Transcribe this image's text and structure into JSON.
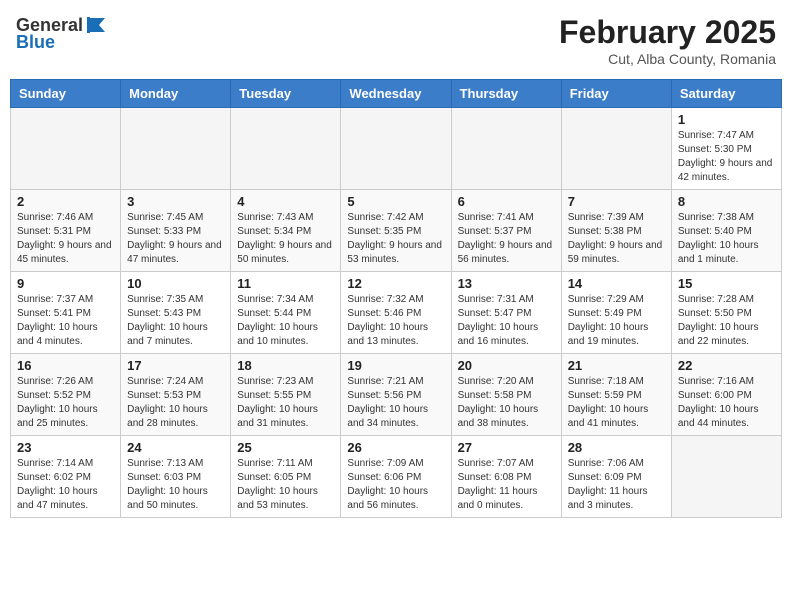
{
  "header": {
    "logo_general": "General",
    "logo_blue": "Blue",
    "month_title": "February 2025",
    "location": "Cut, Alba County, Romania"
  },
  "days_of_week": [
    "Sunday",
    "Monday",
    "Tuesday",
    "Wednesday",
    "Thursday",
    "Friday",
    "Saturday"
  ],
  "weeks": [
    [
      {
        "day": "",
        "info": ""
      },
      {
        "day": "",
        "info": ""
      },
      {
        "day": "",
        "info": ""
      },
      {
        "day": "",
        "info": ""
      },
      {
        "day": "",
        "info": ""
      },
      {
        "day": "",
        "info": ""
      },
      {
        "day": "1",
        "info": "Sunrise: 7:47 AM\nSunset: 5:30 PM\nDaylight: 9 hours and 42 minutes."
      }
    ],
    [
      {
        "day": "2",
        "info": "Sunrise: 7:46 AM\nSunset: 5:31 PM\nDaylight: 9 hours and 45 minutes."
      },
      {
        "day": "3",
        "info": "Sunrise: 7:45 AM\nSunset: 5:33 PM\nDaylight: 9 hours and 47 minutes."
      },
      {
        "day": "4",
        "info": "Sunrise: 7:43 AM\nSunset: 5:34 PM\nDaylight: 9 hours and 50 minutes."
      },
      {
        "day": "5",
        "info": "Sunrise: 7:42 AM\nSunset: 5:35 PM\nDaylight: 9 hours and 53 minutes."
      },
      {
        "day": "6",
        "info": "Sunrise: 7:41 AM\nSunset: 5:37 PM\nDaylight: 9 hours and 56 minutes."
      },
      {
        "day": "7",
        "info": "Sunrise: 7:39 AM\nSunset: 5:38 PM\nDaylight: 9 hours and 59 minutes."
      },
      {
        "day": "8",
        "info": "Sunrise: 7:38 AM\nSunset: 5:40 PM\nDaylight: 10 hours and 1 minute."
      }
    ],
    [
      {
        "day": "9",
        "info": "Sunrise: 7:37 AM\nSunset: 5:41 PM\nDaylight: 10 hours and 4 minutes."
      },
      {
        "day": "10",
        "info": "Sunrise: 7:35 AM\nSunset: 5:43 PM\nDaylight: 10 hours and 7 minutes."
      },
      {
        "day": "11",
        "info": "Sunrise: 7:34 AM\nSunset: 5:44 PM\nDaylight: 10 hours and 10 minutes."
      },
      {
        "day": "12",
        "info": "Sunrise: 7:32 AM\nSunset: 5:46 PM\nDaylight: 10 hours and 13 minutes."
      },
      {
        "day": "13",
        "info": "Sunrise: 7:31 AM\nSunset: 5:47 PM\nDaylight: 10 hours and 16 minutes."
      },
      {
        "day": "14",
        "info": "Sunrise: 7:29 AM\nSunset: 5:49 PM\nDaylight: 10 hours and 19 minutes."
      },
      {
        "day": "15",
        "info": "Sunrise: 7:28 AM\nSunset: 5:50 PM\nDaylight: 10 hours and 22 minutes."
      }
    ],
    [
      {
        "day": "16",
        "info": "Sunrise: 7:26 AM\nSunset: 5:52 PM\nDaylight: 10 hours and 25 minutes."
      },
      {
        "day": "17",
        "info": "Sunrise: 7:24 AM\nSunset: 5:53 PM\nDaylight: 10 hours and 28 minutes."
      },
      {
        "day": "18",
        "info": "Sunrise: 7:23 AM\nSunset: 5:55 PM\nDaylight: 10 hours and 31 minutes."
      },
      {
        "day": "19",
        "info": "Sunrise: 7:21 AM\nSunset: 5:56 PM\nDaylight: 10 hours and 34 minutes."
      },
      {
        "day": "20",
        "info": "Sunrise: 7:20 AM\nSunset: 5:58 PM\nDaylight: 10 hours and 38 minutes."
      },
      {
        "day": "21",
        "info": "Sunrise: 7:18 AM\nSunset: 5:59 PM\nDaylight: 10 hours and 41 minutes."
      },
      {
        "day": "22",
        "info": "Sunrise: 7:16 AM\nSunset: 6:00 PM\nDaylight: 10 hours and 44 minutes."
      }
    ],
    [
      {
        "day": "23",
        "info": "Sunrise: 7:14 AM\nSunset: 6:02 PM\nDaylight: 10 hours and 47 minutes."
      },
      {
        "day": "24",
        "info": "Sunrise: 7:13 AM\nSunset: 6:03 PM\nDaylight: 10 hours and 50 minutes."
      },
      {
        "day": "25",
        "info": "Sunrise: 7:11 AM\nSunset: 6:05 PM\nDaylight: 10 hours and 53 minutes."
      },
      {
        "day": "26",
        "info": "Sunrise: 7:09 AM\nSunset: 6:06 PM\nDaylight: 10 hours and 56 minutes."
      },
      {
        "day": "27",
        "info": "Sunrise: 7:07 AM\nSunset: 6:08 PM\nDaylight: 11 hours and 0 minutes."
      },
      {
        "day": "28",
        "info": "Sunrise: 7:06 AM\nSunset: 6:09 PM\nDaylight: 11 hours and 3 minutes."
      },
      {
        "day": "",
        "info": ""
      }
    ]
  ]
}
